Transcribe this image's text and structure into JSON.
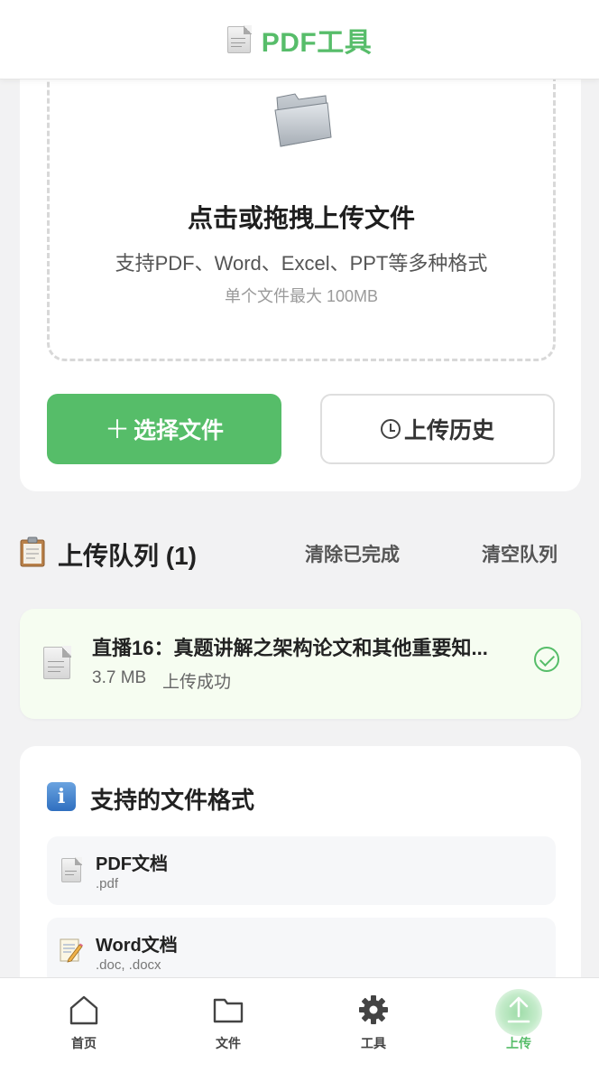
{
  "header": {
    "title": "PDF工具",
    "icon": "document-icon"
  },
  "upload": {
    "icon": "folder-icon",
    "title": "点击或拖拽上传文件",
    "subtitle": "支持PDF、Word、Excel、PPT等多种格式",
    "limit": "单个文件最大 100MB",
    "select_button": "选择文件",
    "history_button": "上传历史"
  },
  "queue": {
    "icon": "clipboard-icon",
    "title": "上传队列 (1)",
    "clear_done": "清除已完成",
    "clear_all": "清空队列",
    "items": [
      {
        "name": "直播16：真题讲解之架构论文和其他重要知...",
        "size": "3.7 MB",
        "status": "上传成功",
        "status_icon": "check-circle-icon"
      }
    ]
  },
  "formats": {
    "icon": "info-icon",
    "title": "支持的文件格式",
    "items": [
      {
        "name": "PDF文档",
        "ext": ".pdf",
        "icon": "pdf-document-icon"
      },
      {
        "name": "Word文档",
        "ext": ".doc, .docx",
        "icon": "memo-icon"
      }
    ]
  },
  "nav": {
    "items": [
      {
        "label": "首页",
        "icon": "home-icon"
      },
      {
        "label": "文件",
        "icon": "folder-icon"
      },
      {
        "label": "工具",
        "icon": "gear-icon"
      },
      {
        "label": "上传",
        "icon": "upload-icon",
        "active": true
      }
    ]
  },
  "colors": {
    "accent": "#56bd69",
    "success_bg": "#f6fdf1",
    "background": "#f2f2f3"
  }
}
